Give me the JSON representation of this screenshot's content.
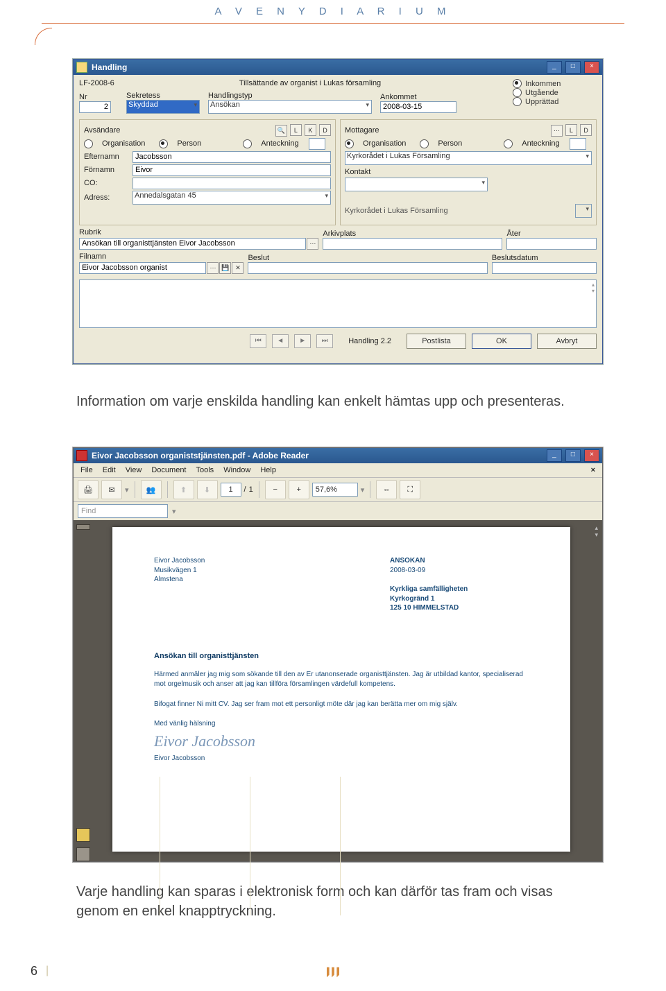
{
  "page": {
    "header": "A V E N Y   D I A R I U M",
    "caption1": "Information om varje enskilda handling kan enkelt hämtas upp och presenteras.",
    "caption2": "Varje handling kan sparas i elektronisk form och kan därför tas fram och visas genom en enkel knapptryckning.",
    "page_number": "6"
  },
  "handling": {
    "title": "Handling",
    "case_ref": "LF-2008-6",
    "case_title": "Tillsättande av organist i Lukas församling",
    "labels": {
      "nr": "Nr",
      "sekretess": "Sekretess",
      "handlingstyp": "Handlingstyp",
      "ankommet": "Ankommet",
      "avsandare": "Avsändare",
      "mottagare": "Mottagare",
      "organisation": "Organisation",
      "person": "Person",
      "anteckning": "Anteckning",
      "efternamn": "Efternamn",
      "fornamn": "Förnamn",
      "co": "CO:",
      "adress": "Adress:",
      "kontakt": "Kontakt",
      "rubrik": "Rubrik",
      "arkivplats": "Arkivplats",
      "ater": "Åter",
      "filnamn": "Filnamn",
      "beslut": "Beslut",
      "beslutsdatum": "Beslutsdatum"
    },
    "values": {
      "nr": "2",
      "sekretess": "Skyddad",
      "handlingstyp": "Ansökan",
      "ankommet": "2008-03-15",
      "efternamn": "Jacobsson",
      "fornamn": "Eivor",
      "co": "",
      "adress": "Annedalsgatan 45",
      "mottagare_org": "Kyrkorådet i Lukas Församling",
      "kontakt": "",
      "mottagare_hint": "Kyrkorådet i Lukas Församling",
      "rubrik": "Ansökan till organisttjänsten Eivor Jacobsson",
      "arkivplats": "",
      "ater": "",
      "filnamn": "Eivor Jacobsson organist",
      "beslut": "",
      "beslutsdatum": ""
    },
    "direction": {
      "inkommen": "Inkommen",
      "utgaende": "Utgående",
      "upprattad": "Upprättad"
    },
    "mini_buttons": [
      "L",
      "K",
      "D"
    ],
    "mini_buttons_right": [
      "L",
      "D"
    ],
    "nav_status": "Handling 2.2",
    "buttons": {
      "postlista": "Postlista",
      "ok": "OK",
      "avbryt": "Avbryt"
    }
  },
  "reader": {
    "title": "Eivor Jacobsson organiststjänsten.pdf - Adobe Reader",
    "menu": [
      "File",
      "Edit",
      "View",
      "Document",
      "Tools",
      "Window",
      "Help"
    ],
    "page_current": "1",
    "page_sep": "/",
    "page_total": "1",
    "zoom": "57,6%",
    "find_placeholder": "Find"
  },
  "pdf": {
    "sender": {
      "name": "Eivor Jacobsson",
      "street": "Musikvägen 1",
      "city": "Almstena"
    },
    "header_right": {
      "type": "ANSOKAN",
      "date": "2008-03-09"
    },
    "recipient": {
      "l1": "Kyrkliga samfälligheten",
      "l2": "Kyrkogränd 1",
      "l3": "125 10  HIMMELSTAD"
    },
    "title": "Ansökan till organisttjänsten",
    "p1": "Härmed anmäler jag mig som sökande till den av Er utanonserade  organisttjänsten. Jag är utbildad kantor, specialiserad mot orgelmusik och anser att jag kan tillföra församlingen värdefull kompetens.",
    "p2": "Bifogat finner Ni mitt CV. Jag ser fram mot ett personligt möte där jag kan berätta mer om mig själv.",
    "closing": "Med vänlig hälsning",
    "signature_script": "Eivor Jacobsson",
    "signature_print": "Eivor Jacobsson"
  }
}
